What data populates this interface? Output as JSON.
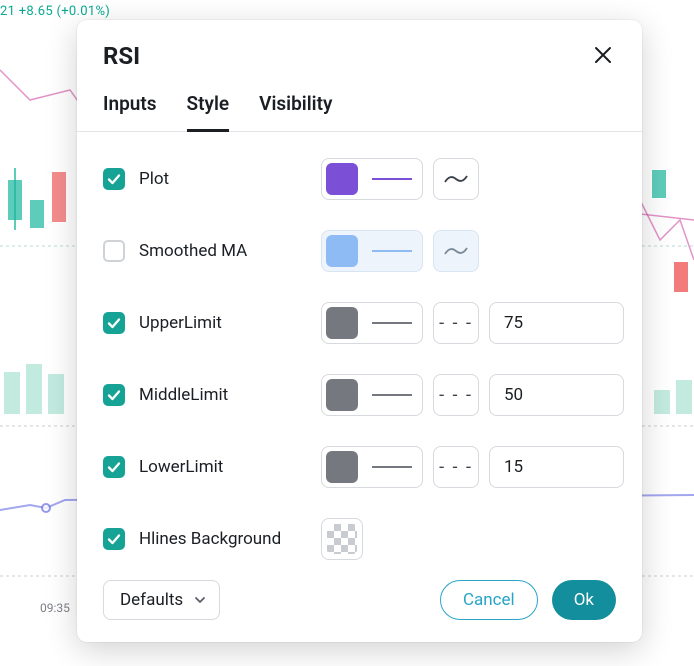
{
  "bg": {
    "quote": "21 +8.65 (+0.01%)",
    "time": "09:35"
  },
  "dialog": {
    "title": "RSI",
    "tabs": {
      "inputs": "Inputs",
      "style": "Style",
      "visibility": "Visibility"
    },
    "rows": {
      "plot": {
        "label": "Plot",
        "checked": true,
        "color": "#7b4fd6"
      },
      "smoothed": {
        "label": "Smoothed MA",
        "checked": false,
        "color": "#8fbbf5"
      },
      "upper": {
        "label": "UpperLimit",
        "checked": true,
        "color": "#75797f",
        "value": "75"
      },
      "middle": {
        "label": "MiddleLimit",
        "checked": true,
        "color": "#75797f",
        "value": "50"
      },
      "lower": {
        "label": "LowerLimit",
        "checked": true,
        "color": "#75797f",
        "value": "15"
      },
      "hlines": {
        "label": "Hlines Background",
        "checked": true
      }
    },
    "footer": {
      "defaults": "Defaults",
      "cancel": "Cancel",
      "ok": "Ok"
    }
  }
}
